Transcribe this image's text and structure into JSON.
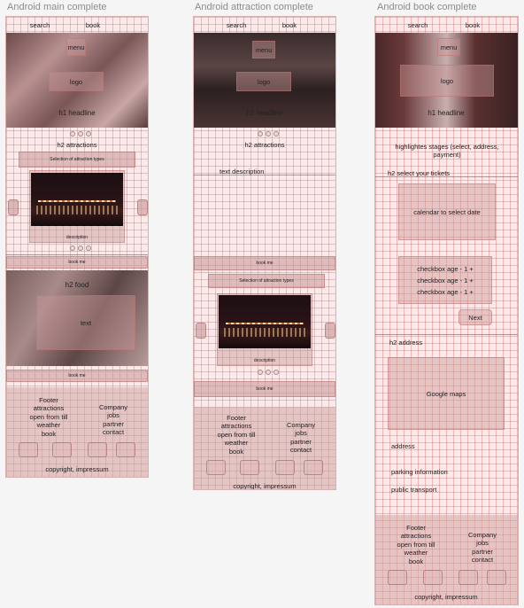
{
  "frames": {
    "main": {
      "title": "Android main complete",
      "nav_search": "search",
      "nav_book": "book",
      "menu": "menu",
      "logo": "logo",
      "h1": "h1 headline",
      "h2_attractions": "h2 attractions",
      "selection": "Selection of attraction types",
      "description": "description",
      "book_me": "book me",
      "h2_food": "h2 food",
      "text": "text",
      "book_me_2": "book me",
      "footer_left": [
        "Footer",
        "attractions",
        "open from till",
        "weather",
        "book"
      ],
      "footer_right": [
        "Company",
        "jobs",
        "partner",
        "contact"
      ],
      "copyright": "copyright, impressum"
    },
    "attraction": {
      "title": "Android attraction complete",
      "nav_search": "search",
      "nav_book": "book",
      "menu": "menu",
      "logo": "logo",
      "h1": "h1 headline",
      "h2_attractions": "h2 attractions",
      "text_description": "text description",
      "book_me": "book me",
      "selection": "Selection of attraction types",
      "description": "description",
      "book_me_2": "book me",
      "footer_left": [
        "Footer",
        "attractions",
        "open from till",
        "weather",
        "book"
      ],
      "footer_right": [
        "Company",
        "jobs",
        "partner",
        "contact"
      ],
      "copyright": "copyright, impressum"
    },
    "book": {
      "title": "Android book complete",
      "nav_search": "search",
      "nav_book": "book",
      "menu": "menu",
      "logo": "logo",
      "h1": "h1 headline",
      "stages": "highlightes stages (select, address, payment)",
      "h2_tickets": "h2 select your tickets",
      "calendar": "calendar to select date",
      "checkbox_1": "checkbox age - 1 +",
      "checkbox_2": "checkbox age - 1 +",
      "checkbox_3": "checkbox age - 1 +",
      "next": "Next",
      "h2_address": "h2 address",
      "maps": "Google maps",
      "address": "address",
      "parking": "parking information",
      "transport": "public transport",
      "footer_left": [
        "Footer",
        "attractions",
        "open from till",
        "weather",
        "book"
      ],
      "footer_right": [
        "Company",
        "jobs",
        "partner",
        "contact"
      ],
      "copyright": "copyright, impressum"
    }
  }
}
